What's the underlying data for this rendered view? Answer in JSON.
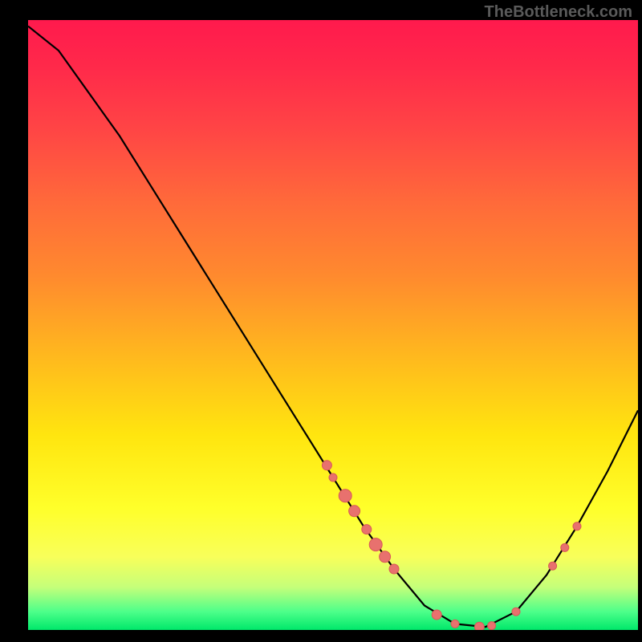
{
  "watermark": "TheBottleneck.com",
  "chart_data": {
    "type": "line",
    "title": "",
    "xlabel": "",
    "ylabel": "",
    "xlim": [
      0,
      100
    ],
    "ylim": [
      0,
      100
    ],
    "curve": [
      {
        "x": 0,
        "y": 99
      },
      {
        "x": 5,
        "y": 95
      },
      {
        "x": 10,
        "y": 88
      },
      {
        "x": 15,
        "y": 81
      },
      {
        "x": 20,
        "y": 73
      },
      {
        "x": 25,
        "y": 65
      },
      {
        "x": 30,
        "y": 57
      },
      {
        "x": 35,
        "y": 49
      },
      {
        "x": 40,
        "y": 41
      },
      {
        "x": 45,
        "y": 33
      },
      {
        "x": 50,
        "y": 25
      },
      {
        "x": 55,
        "y": 17
      },
      {
        "x": 60,
        "y": 10
      },
      {
        "x": 65,
        "y": 4
      },
      {
        "x": 70,
        "y": 1
      },
      {
        "x": 75,
        "y": 0.5
      },
      {
        "x": 80,
        "y": 3
      },
      {
        "x": 85,
        "y": 9
      },
      {
        "x": 90,
        "y": 17
      },
      {
        "x": 95,
        "y": 26
      },
      {
        "x": 100,
        "y": 36
      }
    ],
    "dots": [
      {
        "x": 49,
        "y": 27,
        "r": 6
      },
      {
        "x": 50,
        "y": 25,
        "r": 5
      },
      {
        "x": 52,
        "y": 22,
        "r": 8
      },
      {
        "x": 53.5,
        "y": 19.5,
        "r": 7
      },
      {
        "x": 55.5,
        "y": 16.5,
        "r": 6
      },
      {
        "x": 57,
        "y": 14,
        "r": 8
      },
      {
        "x": 58.5,
        "y": 12,
        "r": 7
      },
      {
        "x": 60,
        "y": 10,
        "r": 6
      },
      {
        "x": 67,
        "y": 2.5,
        "r": 6
      },
      {
        "x": 70,
        "y": 1,
        "r": 5
      },
      {
        "x": 74,
        "y": 0.5,
        "r": 6
      },
      {
        "x": 76,
        "y": 0.7,
        "r": 5
      },
      {
        "x": 80,
        "y": 3,
        "r": 5
      },
      {
        "x": 86,
        "y": 10.5,
        "r": 5
      },
      {
        "x": 88,
        "y": 13.5,
        "r": 5
      },
      {
        "x": 90,
        "y": 17,
        "r": 5
      }
    ]
  }
}
